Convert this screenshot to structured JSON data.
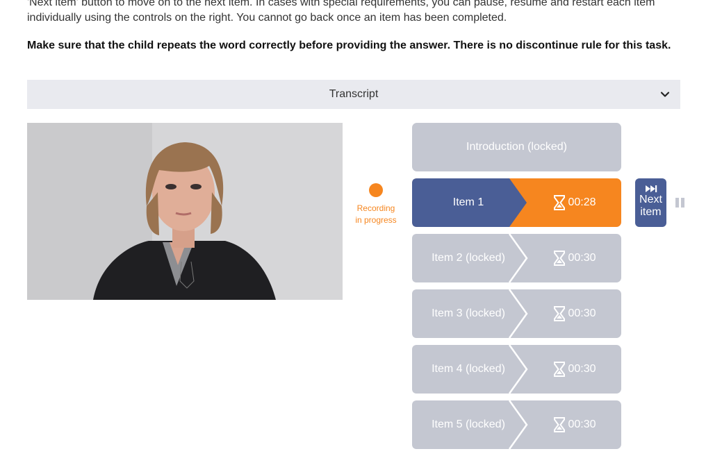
{
  "instructions": {
    "intro": "'Next item' button to move on to the next item. In cases with special requirements, you can pause, resume and restart each item individually using the controls on the right. You cannot go back once an item has been completed.",
    "rule": "Make sure that the child repeats the word correctly before providing the answer. There is no discontinue rule for this task."
  },
  "transcript": {
    "label": "Transcript",
    "icon": "chevron-down-icon"
  },
  "recording": {
    "line1": "Recording",
    "line2": "in progress",
    "color": "#f6861f"
  },
  "introduction": {
    "label": "Introduction  (locked)"
  },
  "items": [
    {
      "label": "Item 1",
      "timer": "00:28",
      "state": "active"
    },
    {
      "label": "Item 2 (locked)",
      "timer": "00:30",
      "state": "locked"
    },
    {
      "label": "Item 3 (locked)",
      "timer": "00:30",
      "state": "locked"
    },
    {
      "label": "Item 4 (locked)",
      "timer": "00:30",
      "state": "locked"
    },
    {
      "label": "Item 5 (locked)",
      "timer": "00:30",
      "state": "locked"
    }
  ],
  "controls": {
    "next_line1": "Next",
    "next_line2": "item",
    "next_icon": "skip-forward-icon",
    "pause_icon": "pause-icon"
  },
  "colors": {
    "active_label": "#4a5e96",
    "active_timer": "#f6861f",
    "locked": "#c4c7d1",
    "transcript_bg": "#e9eaef"
  }
}
